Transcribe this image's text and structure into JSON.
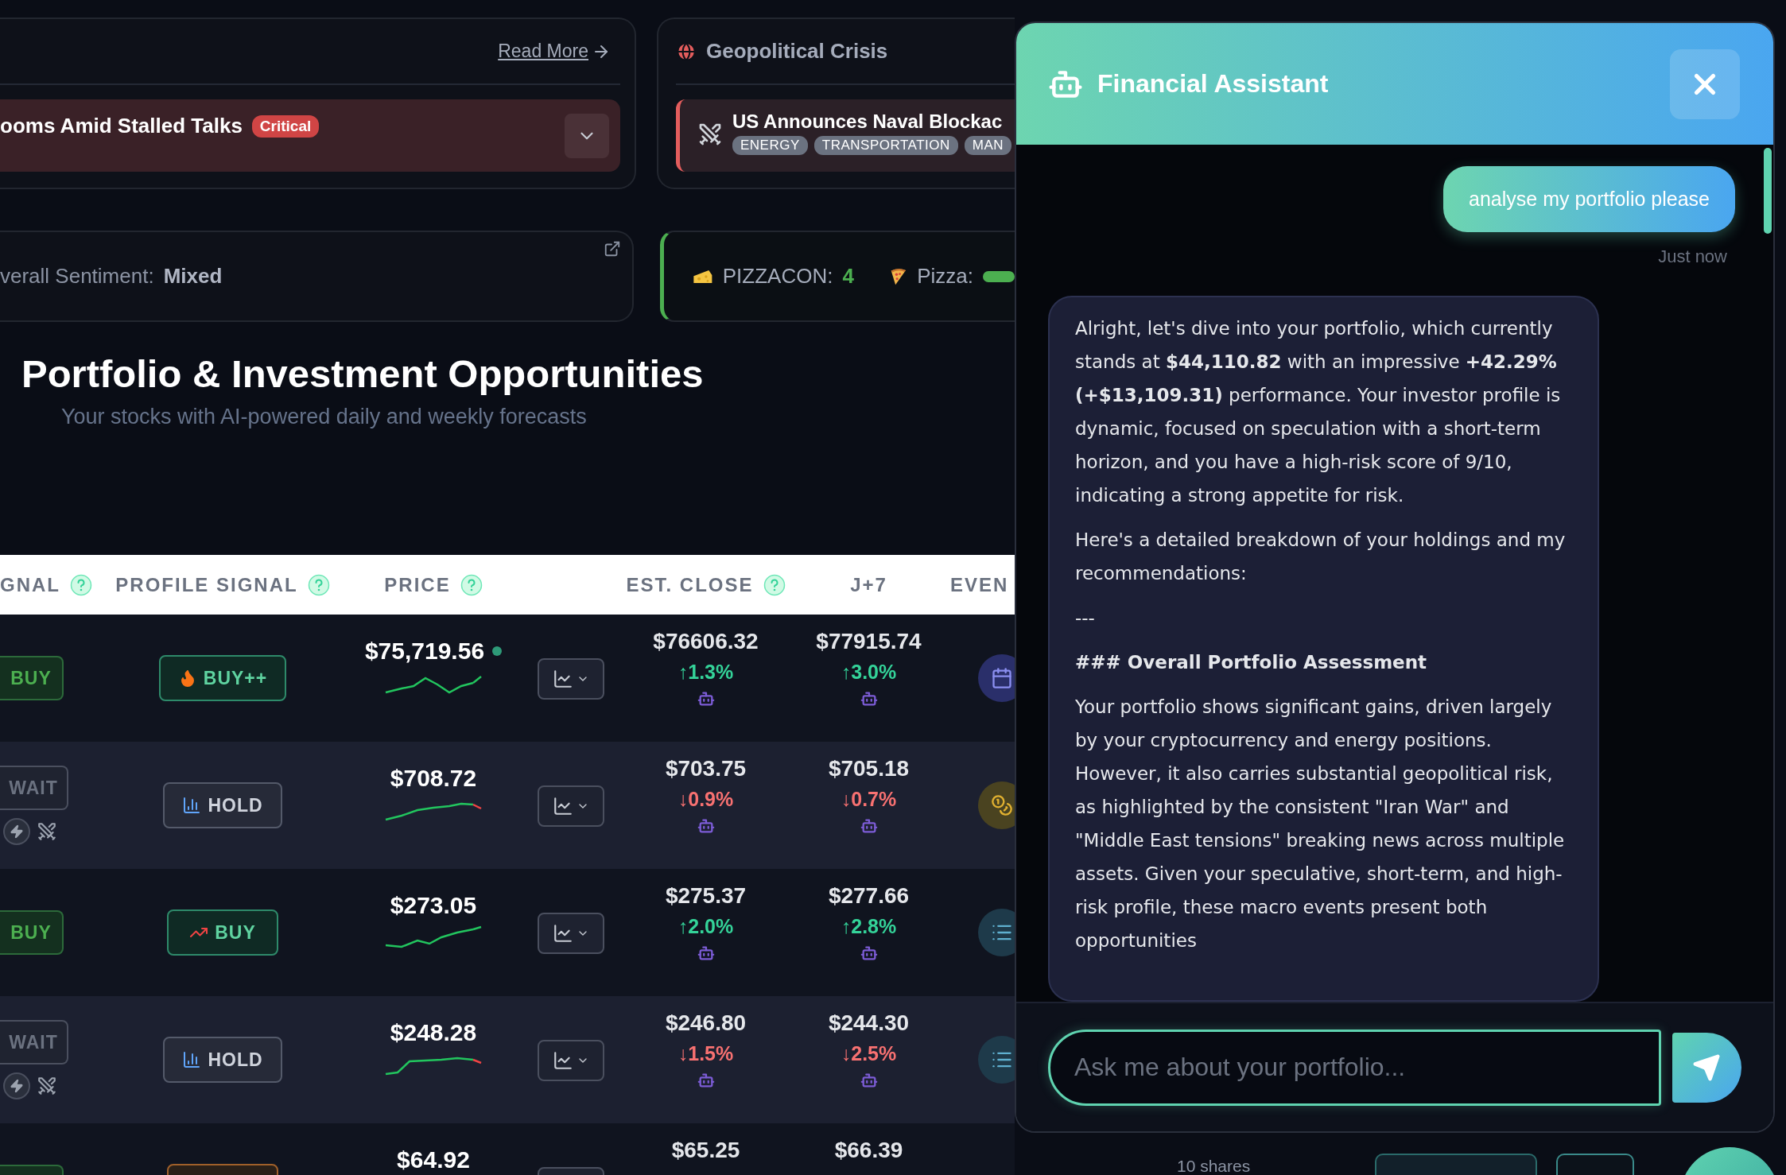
{
  "news_card": {
    "link": "Read More",
    "headline": "ooms Amid Stalled Talks",
    "badge": "Critical"
  },
  "crisis_card": {
    "title": "Geopolitical Crisis",
    "item": {
      "title": "US Announces Naval Blockac",
      "tags": [
        "ENERGY",
        "TRANSPORTATION",
        "MAN"
      ]
    }
  },
  "sentiment_card": {
    "label": "verall Sentiment:",
    "value": "Mixed"
  },
  "pizza_card": {
    "label": "PIZZACON:",
    "value": "4",
    "second_label": "Pizza:"
  },
  "section": {
    "title": "Portfolio & Investment Opportunities",
    "subtitle": "Your stocks with AI-powered daily and weekly forecasts"
  },
  "table": {
    "columns": [
      {
        "label": "GNAL",
        "help": true
      },
      {
        "label": "PROFILE SIGNAL",
        "help": true
      },
      {
        "label": "PRICE",
        "help": true
      },
      {
        "label": "EST. CLOSE",
        "help": true
      },
      {
        "label": "J+7",
        "help": false
      },
      {
        "label": "EVEN",
        "help": false
      }
    ],
    "rows": [
      {
        "signal": {
          "label": "BUY",
          "kind": "buy"
        },
        "alerts": false,
        "profile": {
          "label": "BUY++",
          "kind": "hot"
        },
        "price": "$75,719.56",
        "live": true,
        "sparkline": {
          "falling_tail": false
        },
        "est": {
          "value": "$76606.32",
          "change": "↑1.3%",
          "rising": true
        },
        "j7": {
          "value": "$77915.74",
          "change": "↑3.0%",
          "rising": true
        },
        "event": {
          "kind": "calendar"
        }
      },
      {
        "signal": {
          "label": "WAIT",
          "kind": "wait"
        },
        "alerts": true,
        "profile": {
          "label": "HOLD",
          "kind": "hold"
        },
        "price": "$708.72",
        "live": false,
        "sparkline": {
          "falling_tail": true
        },
        "est": {
          "value": "$703.75",
          "change": "↓0.9%",
          "rising": false
        },
        "j7": {
          "value": "$705.18",
          "change": "↓0.7%",
          "rising": false
        },
        "event": {
          "kind": "coins"
        }
      },
      {
        "signal": {
          "label": "BUY",
          "kind": "buy"
        },
        "alerts": false,
        "profile": {
          "label": "BUY",
          "kind": "buy"
        },
        "price": "$273.05",
        "live": false,
        "sparkline": {
          "falling_tail": false
        },
        "est": {
          "value": "$275.37",
          "change": "↑2.0%",
          "rising": true
        },
        "j7": {
          "value": "$277.66",
          "change": "↑2.8%",
          "rising": true
        },
        "event": {
          "kind": "list"
        }
      },
      {
        "signal": {
          "label": "WAIT",
          "kind": "wait"
        },
        "alerts": true,
        "profile": {
          "label": "HOLD",
          "kind": "hold"
        },
        "price": "$248.28",
        "live": false,
        "sparkline": {
          "falling_tail": true
        },
        "est": {
          "value": "$246.80",
          "change": "↓1.5%",
          "rising": false
        },
        "j7": {
          "value": "$244.30",
          "change": "↓2.5%",
          "rising": false
        },
        "event": {
          "kind": "list"
        }
      },
      {
        "signal": {
          "kind": "buy"
        },
        "profile": {
          "kind": "warn"
        },
        "price": "$64.92",
        "est": {
          "value": "$65.25"
        },
        "j7": {
          "value": "$66.39"
        }
      }
    ]
  },
  "chat": {
    "title": "Financial Assistant",
    "messages": [
      {
        "kind": "user",
        "text": "analyse my portfolio please",
        "time": "Just now"
      },
      {
        "kind": "assistant",
        "paragraphs": [
          {
            "kind": "text",
            "text": "Alright, let's dive into your portfolio, which currently stands at **$44,110.82** with an impressive **+42.29% (+$13,109.31)** performance. Your investor profile is dynamic, focused on speculation with a short-term horizon, and you have a high-risk score of 9/10, indicating a strong appetite for risk."
          },
          {
            "kind": "text",
            "text": "Here's a detailed breakdown of your holdings and my recommendations:"
          },
          {
            "kind": "rule",
            "text": "---"
          },
          {
            "kind": "heading",
            "text": "### Overall Portfolio Assessment"
          },
          {
            "kind": "text",
            "text": "Your portfolio shows significant gains, driven largely by your cryptocurrency and energy positions. However, it also carries substantial geopolitical risk, as highlighted by the consistent \"Iran War\" and \"Middle East tensions\" breaking news across multiple assets. Given your speculative, short-term, and high-risk profile, these macro events present both opportunities"
          }
        ]
      }
    ],
    "input": {
      "placeholder": "Ask me about your portfolio..."
    }
  },
  "footer": {
    "shares": "10 shares"
  }
}
